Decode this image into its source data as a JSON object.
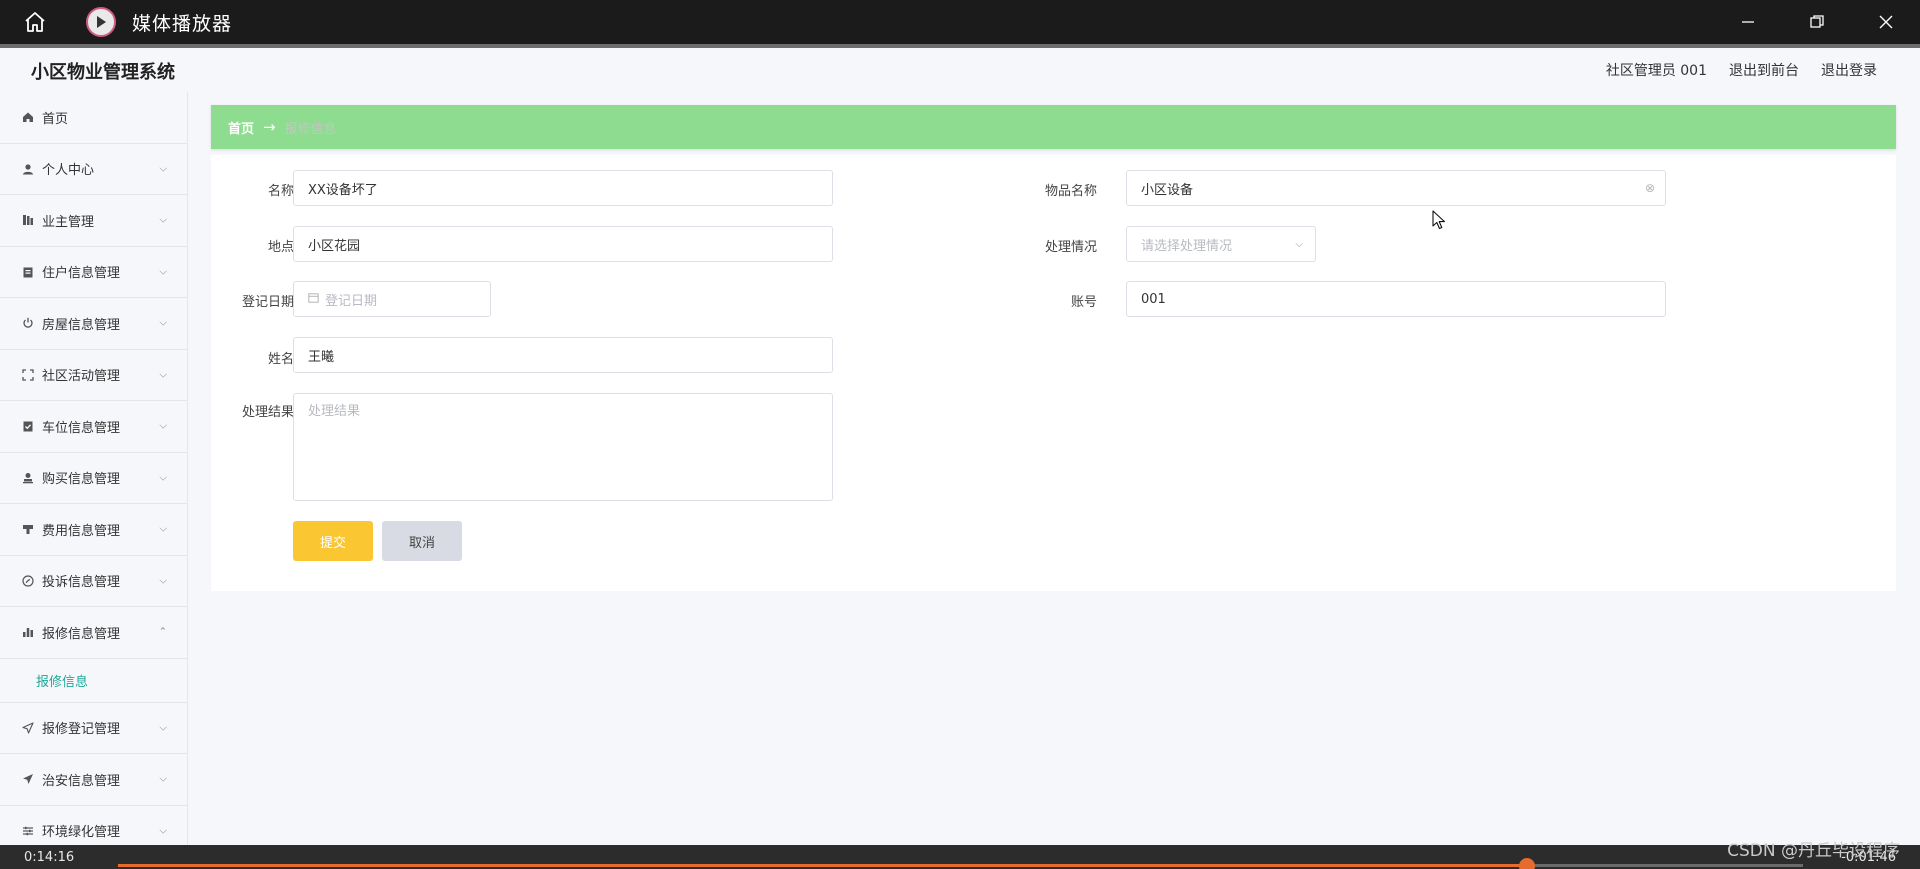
{
  "player": {
    "title": "媒体播放器",
    "time_elapsed": "0:14:16",
    "time_remaining": "-0:01:46",
    "progress_fraction": 0.836,
    "watermark": "CSDN @丹丘毕设程序"
  },
  "app": {
    "title": "小区物业管理系统",
    "user_label": "社区管理员 001",
    "back_to_front": "退出到前台",
    "logout": "退出登录"
  },
  "sidebar": {
    "items": [
      {
        "label": "首页",
        "icon": "home-icon",
        "expandable": false
      },
      {
        "label": "个人中心",
        "icon": "user-icon",
        "expandable": true
      },
      {
        "label": "业主管理",
        "icon": "building-icon",
        "expandable": true
      },
      {
        "label": "住户信息管理",
        "icon": "clipboard-icon",
        "expandable": true
      },
      {
        "label": "房屋信息管理",
        "icon": "power-icon",
        "expandable": true
      },
      {
        "label": "社区活动管理",
        "icon": "fullscreen-icon",
        "expandable": true
      },
      {
        "label": "车位信息管理",
        "icon": "clipboard-check-icon",
        "expandable": true
      },
      {
        "label": "购买信息管理",
        "icon": "stamp-icon",
        "expandable": true
      },
      {
        "label": "费用信息管理",
        "icon": "tag-icon",
        "expandable": true
      },
      {
        "label": "投诉信息管理",
        "icon": "compass-icon",
        "expandable": true
      },
      {
        "label": "报修信息管理",
        "icon": "bar-chart-icon",
        "expandable": true,
        "expanded": true
      },
      {
        "label": "报修登记管理",
        "icon": "send-icon",
        "expandable": true
      },
      {
        "label": "治安信息管理",
        "icon": "paper-plane-icon",
        "expandable": true
      },
      {
        "label": "环境绿化管理",
        "icon": "sliders-icon",
        "expandable": true
      }
    ],
    "submenu_active": "报修信息"
  },
  "breadcrumb": {
    "home": "首页",
    "current": "报修信息"
  },
  "form": {
    "name_label": "名称",
    "name_value": "XX设备坏了",
    "item_label": "物品名称",
    "item_value": "小区设备",
    "location_label": "地点",
    "location_value": "小区花园",
    "status_label": "处理情况",
    "status_placeholder": "请选择处理情况",
    "date_label": "登记日期",
    "date_placeholder": "登记日期",
    "account_label": "账号",
    "account_value": "001",
    "person_label": "姓名",
    "person_value": "王曦",
    "result_label": "处理结果",
    "result_placeholder": "处理结果",
    "submit_label": "提交",
    "cancel_label": "取消"
  },
  "colors": {
    "breadcrumb_bg": "#8ddc8f",
    "submit_bg": "#fac733",
    "active_submenu": "#1fa899",
    "progress": "#e66b2c"
  }
}
